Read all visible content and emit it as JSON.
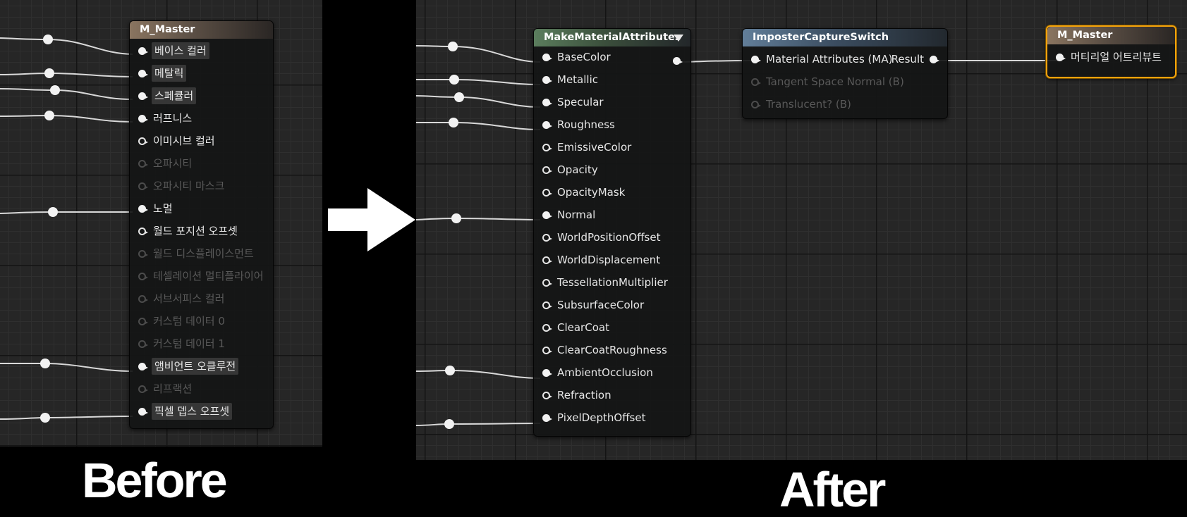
{
  "captions": {
    "before": "Before",
    "after": "After"
  },
  "icons": {
    "transition": "right-arrow-icon",
    "pin_expand": "chevron-down-icon"
  },
  "colors": {
    "selection": "#f2a20c",
    "wire": "#d9d9d9",
    "grid": "#262626"
  },
  "before": {
    "node": {
      "title": "M_Master",
      "pins": [
        {
          "label": "베이스 컬러",
          "state": "connected",
          "highlight": true
        },
        {
          "label": "메탈릭",
          "state": "connected",
          "highlight": true
        },
        {
          "label": "스페큘러",
          "state": "connected",
          "highlight": true
        },
        {
          "label": "러프니스",
          "state": "connected",
          "highlight": false
        },
        {
          "label": "이미시브 컬러",
          "state": "open",
          "highlight": false
        },
        {
          "label": "오파시티",
          "state": "disabled",
          "highlight": false
        },
        {
          "label": "오파시티 마스크",
          "state": "disabled",
          "highlight": false
        },
        {
          "label": "노멀",
          "state": "connected",
          "highlight": false
        },
        {
          "label": "월드 포지션 오프셋",
          "state": "open",
          "highlight": false
        },
        {
          "label": "월드 디스플레이스먼트",
          "state": "disabled",
          "highlight": false
        },
        {
          "label": "테셀레이션 멀티플라이어",
          "state": "disabled",
          "highlight": false
        },
        {
          "label": "서브서피스 컬러",
          "state": "disabled",
          "highlight": false
        },
        {
          "label": "커스텀 데이터 0",
          "state": "disabled",
          "highlight": false
        },
        {
          "label": "커스텀 데이터 1",
          "state": "disabled",
          "highlight": false
        },
        {
          "label": "앰비언트 오클루전",
          "state": "connected",
          "highlight": true
        },
        {
          "label": "리프랙션",
          "state": "disabled",
          "highlight": false
        },
        {
          "label": "픽셀 뎁스 오프셋",
          "state": "connected",
          "highlight": true
        }
      ]
    }
  },
  "after": {
    "make_node": {
      "title": "MakeMaterialAttributes",
      "output_pin": "",
      "pins": [
        {
          "label": "BaseColor",
          "state": "connected"
        },
        {
          "label": "Metallic",
          "state": "connected"
        },
        {
          "label": "Specular",
          "state": "connected"
        },
        {
          "label": "Roughness",
          "state": "connected"
        },
        {
          "label": "EmissiveColor",
          "state": "open"
        },
        {
          "label": "Opacity",
          "state": "open"
        },
        {
          "label": "OpacityMask",
          "state": "open"
        },
        {
          "label": "Normal",
          "state": "connected"
        },
        {
          "label": "WorldPositionOffset",
          "state": "open"
        },
        {
          "label": "WorldDisplacement",
          "state": "open"
        },
        {
          "label": "TessellationMultiplier",
          "state": "open"
        },
        {
          "label": "SubsurfaceColor",
          "state": "open"
        },
        {
          "label": "ClearCoat",
          "state": "open"
        },
        {
          "label": "ClearCoatRoughness",
          "state": "open"
        },
        {
          "label": "AmbientOcclusion",
          "state": "connected"
        },
        {
          "label": "Refraction",
          "state": "open"
        },
        {
          "label": "PixelDepthOffset",
          "state": "connected"
        }
      ]
    },
    "switch_node": {
      "title": "ImposterCaptureSwitch",
      "output_label": "Result",
      "pins": [
        {
          "label": "Material Attributes (MA)",
          "state": "connected"
        },
        {
          "label": "Tangent Space Normal (B)",
          "state": "disabled"
        },
        {
          "label": "Translucent? (B)",
          "state": "disabled"
        }
      ]
    },
    "master_node": {
      "title": "M_Master",
      "pins": [
        {
          "label": "머티리얼 어트리뷰트",
          "state": "connected"
        }
      ]
    }
  }
}
